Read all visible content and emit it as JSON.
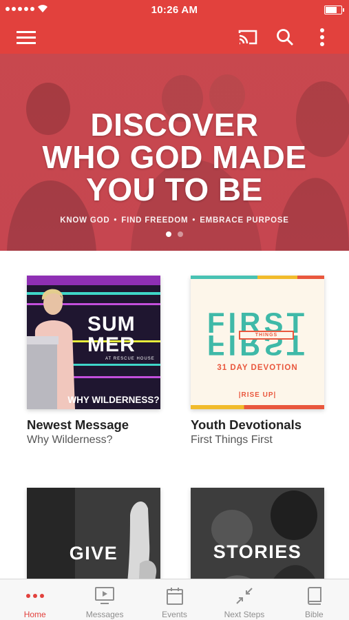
{
  "status_bar": {
    "time": "10:26 AM"
  },
  "app_bar": {
    "menu_icon": "hamburger-menu-icon",
    "cast_icon": "cast-icon",
    "search_icon": "search-icon",
    "more_icon": "more-vertical-icon",
    "color": "#e2413d"
  },
  "hero": {
    "title_lines": [
      "DISCOVER",
      "WHO GOD MADE",
      "YOU TO BE"
    ],
    "tagline_items": [
      "KNOW GOD",
      "FIND FREEDOM",
      "EMBRACE PURPOSE"
    ],
    "tagline_separator": "•",
    "page_count": 2,
    "active_page": 1
  },
  "cards": [
    {
      "title": "Newest Message",
      "subtitle": "Why Wilderness?",
      "art_lines": [
        "SUM",
        "MER"
      ],
      "art_small": "AT RESCUE HOUSE",
      "art_banner": "WHY WILDERNESS?"
    },
    {
      "title": "Youth Devotionals",
      "subtitle": "First Things First",
      "art_big": "FIRST",
      "art_small": "THINGS",
      "art_sub": "31 DAY DEVOTION",
      "art_footer": "|RISE UP|"
    },
    {
      "art_word": "GIVE"
    },
    {
      "art_word": "STORIES"
    }
  ],
  "tabs": [
    {
      "label": "Home",
      "icon": "dots-icon",
      "active": true
    },
    {
      "label": "Messages",
      "icon": "video-play-icon",
      "active": false
    },
    {
      "label": "Events",
      "icon": "calendar-icon",
      "active": false
    },
    {
      "label": "Next Steps",
      "icon": "arrows-collapse-icon",
      "active": false
    },
    {
      "label": "Bible",
      "icon": "book-icon",
      "active": false
    }
  ],
  "colors": {
    "accent": "#e2413d",
    "tab_inactive": "#8e8e8e"
  }
}
